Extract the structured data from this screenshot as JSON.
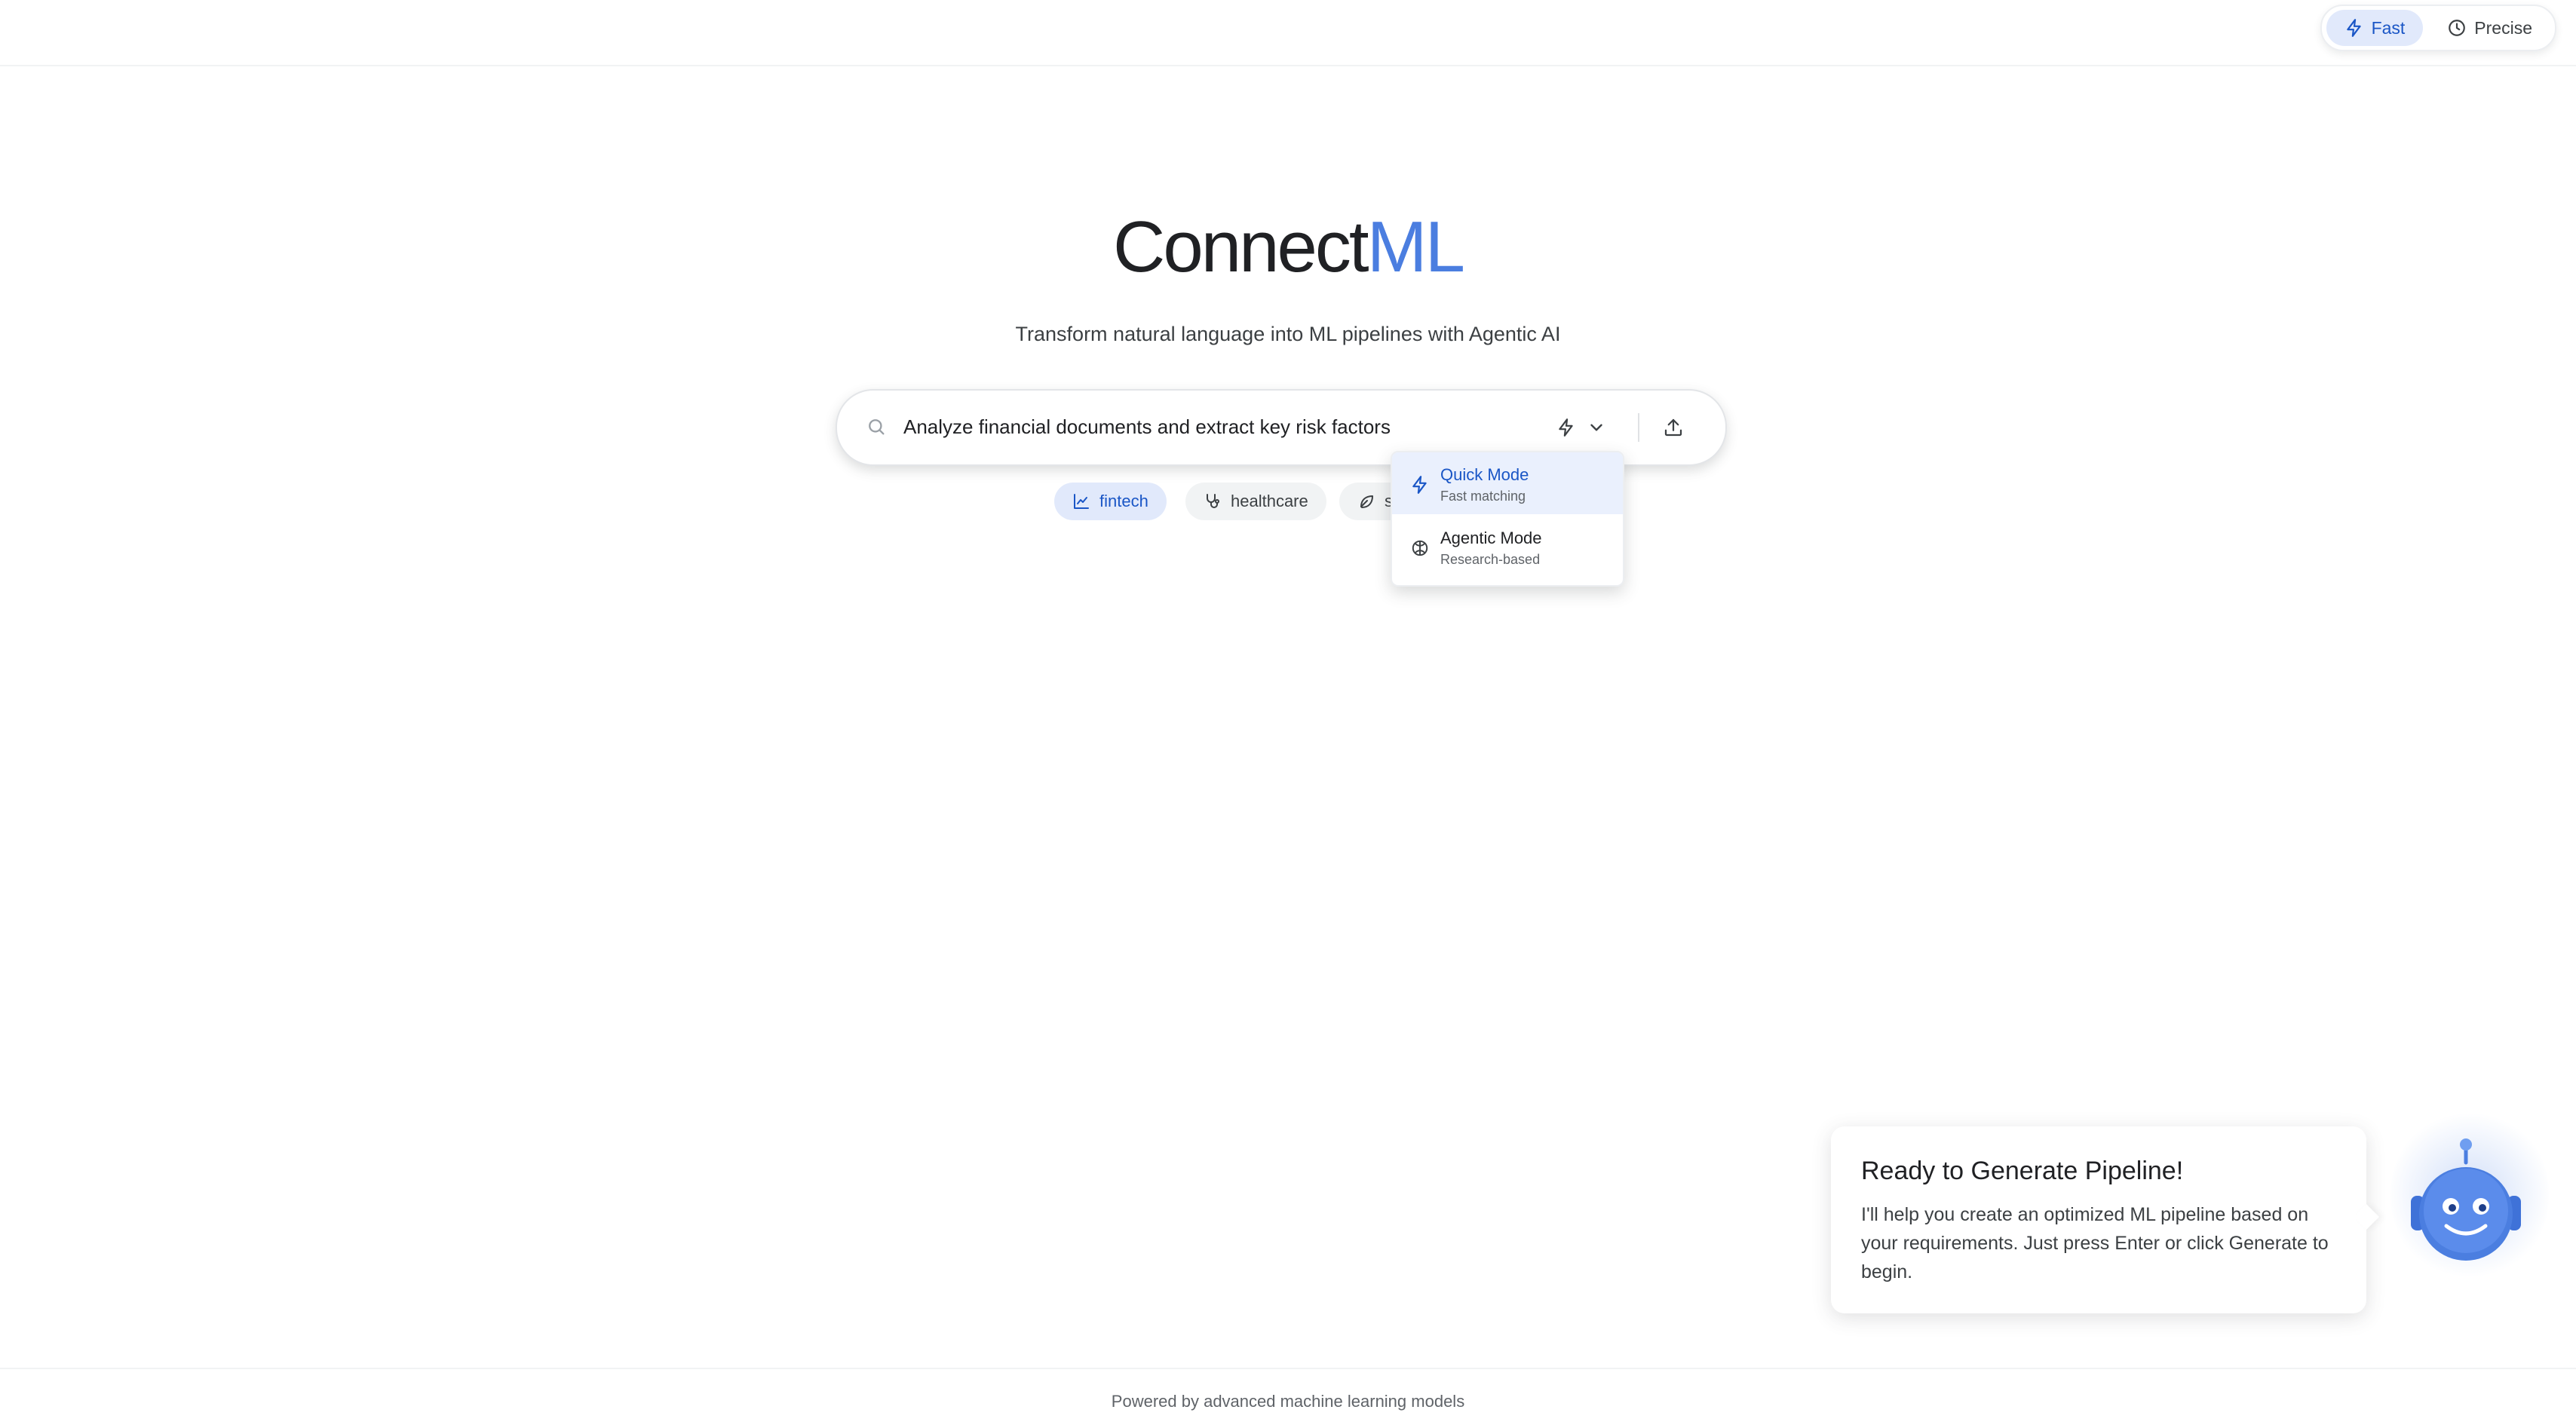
{
  "header": {
    "modes": [
      {
        "label": "Fast",
        "icon": "lightning-icon",
        "active": true
      },
      {
        "label": "Precise",
        "icon": "clock-icon",
        "active": false
      }
    ]
  },
  "hero": {
    "logo_part1": "Connect",
    "logo_part2": "ML",
    "tagline": "Transform natural language into ML pipelines with Agentic AI"
  },
  "search": {
    "value": "Analyze financial documents and extract key risk factors",
    "mode_icon": "lightning-icon",
    "upload_icon": "upload-icon"
  },
  "chips": [
    {
      "label": "fintech",
      "icon": "trend-chart-icon",
      "active": true
    },
    {
      "label": "healthcare",
      "icon": "stethoscope-icon",
      "active": false
    },
    {
      "label": "s",
      "icon": "leaf-icon",
      "active": false
    }
  ],
  "dropdown": {
    "items": [
      {
        "title": "Quick Mode",
        "subtitle": "Fast matching",
        "icon": "lightning-icon",
        "selected": true
      },
      {
        "title": "Agentic Mode",
        "subtitle": "Research-based",
        "icon": "brain-icon",
        "selected": false
      }
    ]
  },
  "assistant": {
    "title": "Ready to Generate Pipeline!",
    "message": "I'll help you create an optimized ML pipeline based on your requirements. Just press Enter or click Generate to begin.",
    "avatar_icon": "robot-icon"
  },
  "footer": {
    "text": "Powered by advanced machine learning models"
  },
  "colors": {
    "accent": "#4b7ee0",
    "accent_dark": "#1a56c6",
    "accent_light": "#e1e9fb",
    "text": "#202124",
    "muted": "#5f6368"
  }
}
